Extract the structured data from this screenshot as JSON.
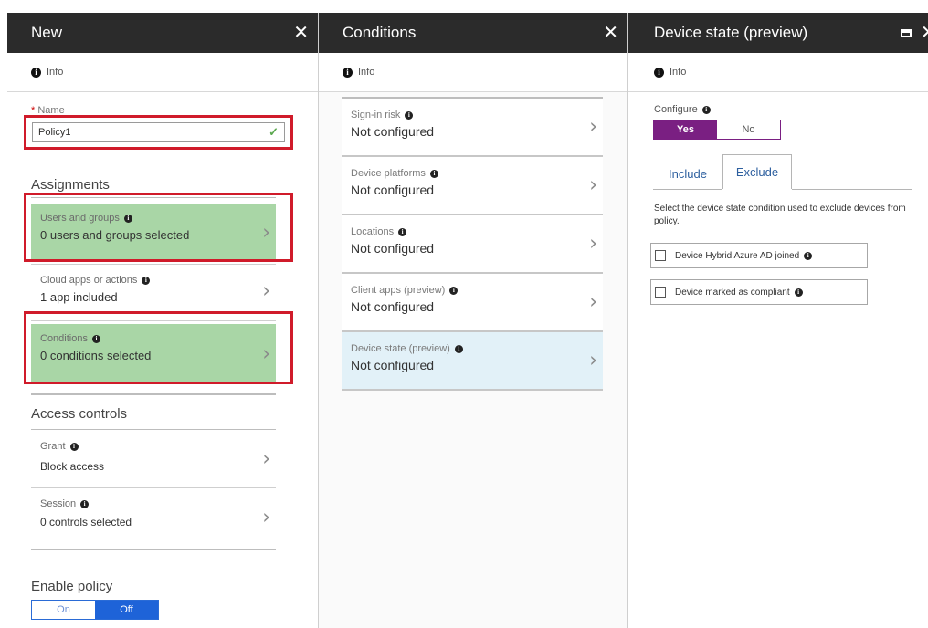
{
  "new_blade": {
    "title": "New",
    "info": "Info",
    "name_label": "Name",
    "name_value": "Policy1",
    "assignments_heading": "Assignments",
    "users_title": "Users and groups",
    "users_value": "0 users and groups selected",
    "cloud_title": "Cloud apps or actions",
    "cloud_value": "1 app included",
    "conditions_title": "Conditions",
    "conditions_value": "0  conditions  selected",
    "access_heading": "Access controls",
    "grant_title": "Grant",
    "grant_value": "Block access",
    "session_title": "Session",
    "session_value": "0 controls selected",
    "enable_heading": "Enable policy",
    "toggle_on": "On",
    "toggle_off": "Off"
  },
  "conditions_blade": {
    "title": "Conditions",
    "info": "Info",
    "items": [
      {
        "title": "Sign-in risk",
        "value": "Not configured"
      },
      {
        "title": "Device platforms",
        "value": "Not configured"
      },
      {
        "title": "Locations",
        "value": "Not configured"
      },
      {
        "title": "Client apps (preview)",
        "value": "Not configured"
      },
      {
        "title": "Device state (preview)",
        "value": "Not configured"
      }
    ]
  },
  "device_blade": {
    "title": "Device state (preview)",
    "info": "Info",
    "configure_label": "Configure",
    "yes": "Yes",
    "no": "No",
    "tab_include": "Include",
    "tab_exclude": "Exclude",
    "description": "Select the device state condition used to exclude devices from policy.",
    "option1": "Device Hybrid Azure AD joined",
    "option2": "Device marked as compliant"
  },
  "colors": {
    "header_bg": "#2b2b2b",
    "highlight_red": "#d01b2a",
    "selected_green": "#a9d6a6",
    "toggle_blue": "#1e63d8",
    "configure_purple": "#7a1f82",
    "selected_item_blue": "#e2f1f8"
  },
  "icons": {
    "info": "info-circle-icon",
    "close": "close-icon",
    "maximize": "maximize-icon",
    "chevron": "chevron-right-icon",
    "check": "checkmark-icon"
  }
}
